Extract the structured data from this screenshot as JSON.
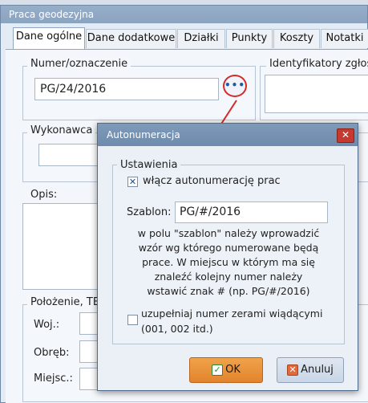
{
  "window": {
    "title": "Praca geodezyjna"
  },
  "tabs": [
    {
      "label": "Dane ogólne"
    },
    {
      "label": "Dane dodatkowe"
    },
    {
      "label": "Działki"
    },
    {
      "label": "Punkty"
    },
    {
      "label": "Koszty"
    },
    {
      "label": "Notatki"
    }
  ],
  "main": {
    "number_group_label": "Numer/oznaczenie",
    "number_value": "PG/24/2016",
    "dots_button_label": "•••",
    "identifiers_label": "Identyfikatory zgłosz",
    "contractor_label": "Wykonawca",
    "description_label": "Opis:",
    "location_label": "Położenie, TER",
    "voivodeship_label": "Woj.:",
    "precinct_label": "Obręb:",
    "locality_label": "Miejsc.:"
  },
  "dialog": {
    "title": "Autonumeracja",
    "settings_label": "Ustawienia",
    "auto_checkbox_label": "włącz autonumerację prac",
    "auto_checked": true,
    "template_label": "Szablon:",
    "template_value": "PG/#/2016",
    "help_lines": [
      "w polu \"szablon\" należy wprowadzić",
      "wzór wg którego numerowane będą",
      "prace. W miejscu w którym ma się",
      "znaleźć kolejny numer należy",
      "wstawić znak # (np. PG/#/2016)"
    ],
    "zero_checkbox_line1": "uzupełniaj numer zerami wiądącymi",
    "zero_checkbox_line2": "(001, 002 itd.)",
    "zero_checked": false,
    "ok_label": "OK",
    "cancel_label": "Anuluj"
  },
  "colors": {
    "annotation_red": "#d42a2a",
    "ok_orange": "#e1842d"
  }
}
